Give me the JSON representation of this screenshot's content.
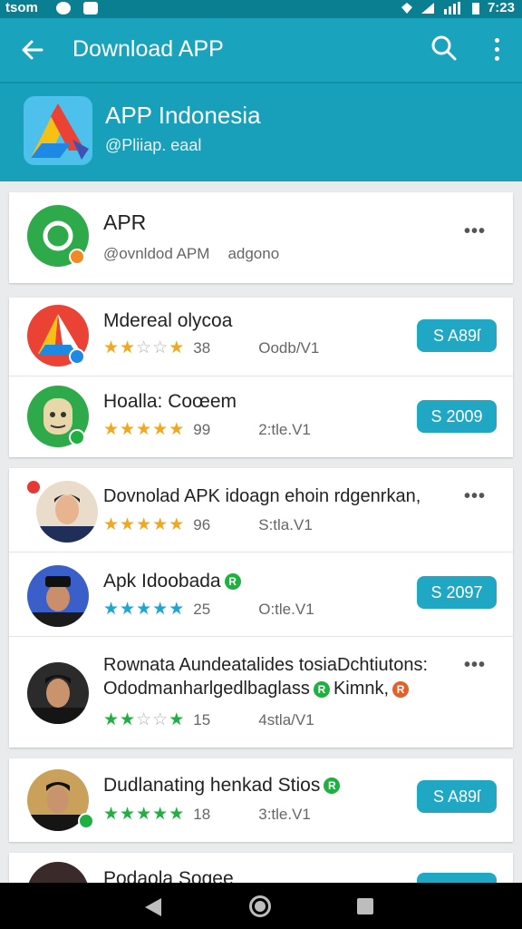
{
  "status_bar": {
    "carrier": "tsom",
    "time": "7:23"
  },
  "app_bar": {
    "title": "Download APP",
    "back_icon": "arrow-left-icon",
    "search_icon": "search-icon",
    "more_icon": "more-vert-icon"
  },
  "header": {
    "title": "APP Indonesia",
    "subtitle": "@Pliiap. eaal"
  },
  "featured": {
    "title": "APR",
    "subtitle": "@ovnldod APM",
    "subtitle2": "adgono"
  },
  "colors": {
    "accent": "#1fa7c4",
    "appbar": "#1aa3bd",
    "star_gold": "#f0a81e",
    "star_blue": "#1ba6d6",
    "star_green": "#1eb040",
    "star_grey": "#b0b0b0"
  },
  "items": [
    {
      "title": "Mdereal olycoa",
      "rating": "38",
      "version": "Oodb/V1",
      "button": "S A89ſ",
      "stars": [
        1,
        1,
        0,
        0,
        1
      ]
    },
    {
      "title": "Hoalla: Coœem",
      "rating": "99",
      "version": "2:tle.V1",
      "button": "S 2009",
      "stars": [
        1,
        1,
        1,
        1,
        1
      ]
    },
    {
      "title": "Dovnolad APK idoagn ehoin rdgenrkan,",
      "rating": "96",
      "version": "S:tla.V1",
      "stars": [
        1,
        1,
        1,
        1,
        1
      ]
    },
    {
      "title": "Apk Idoobada",
      "rating": "25",
      "version": "O:tle.V1",
      "button": "S 2097",
      "stars": [
        1,
        1,
        1,
        1,
        1
      ]
    },
    {
      "title": "Rownata Aundeatalides tosiaDchtiutons:",
      "title2": "Ododmanharlgedlbaglass",
      "title2b": "Kimnk,",
      "rating": "15",
      "version": "4stla/V1",
      "stars": [
        1,
        1,
        0,
        0,
        1
      ]
    },
    {
      "title": "Dudlanating henkad Stios",
      "rating": "18",
      "version": "3:tle.V1",
      "button": "S A89ſ",
      "stars": [
        1,
        1,
        1,
        1,
        1
      ]
    },
    {
      "title": "Podaola Sogee"
    }
  ],
  "verified_badge": "R",
  "featured_menu": "•••",
  "row_menu": "•••"
}
